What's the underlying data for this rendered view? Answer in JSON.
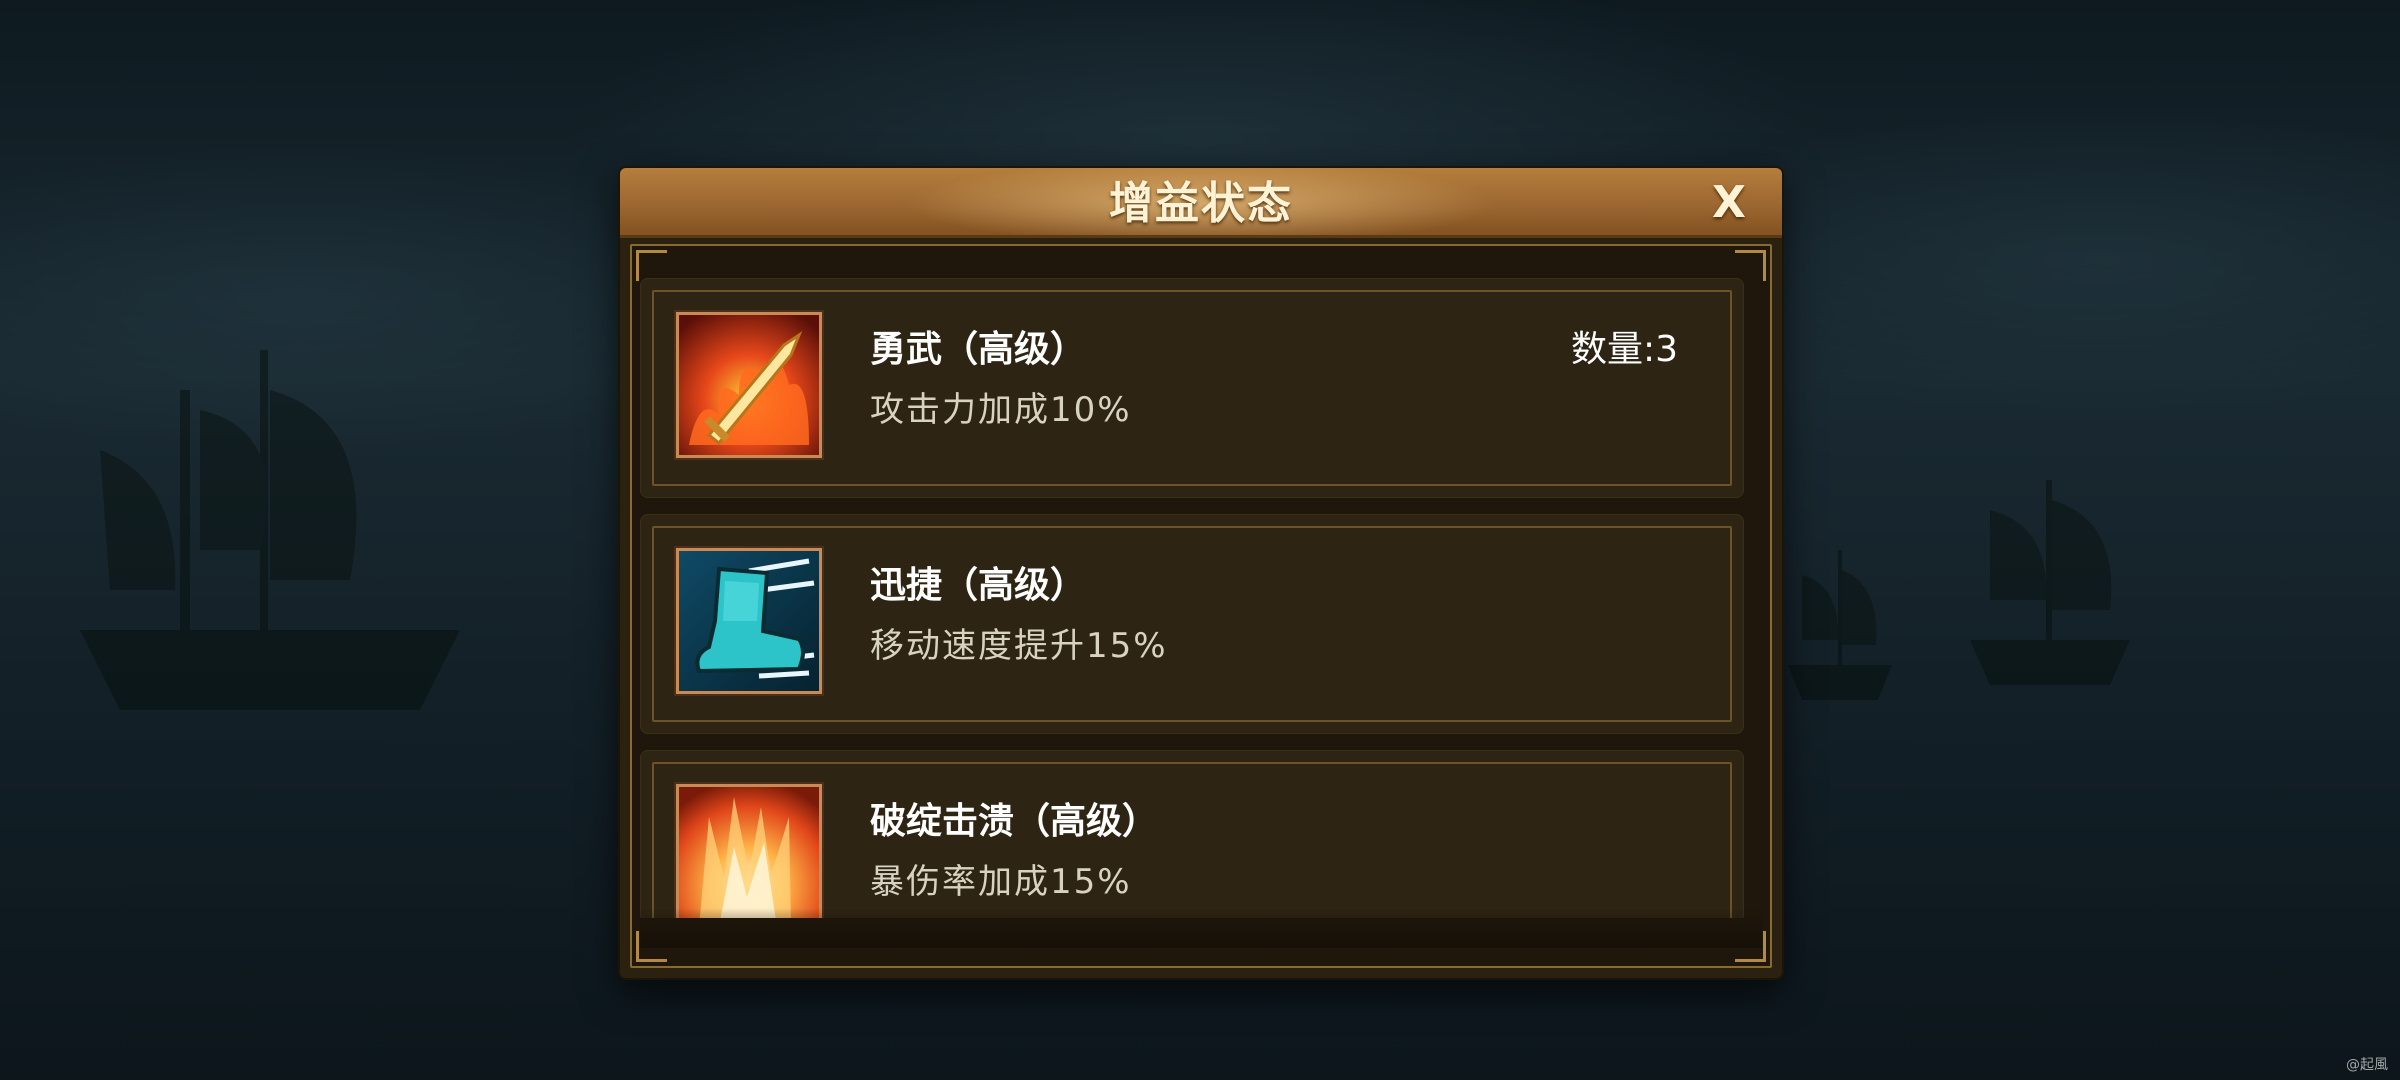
{
  "dialog": {
    "title": "增益状态",
    "close_label": "X"
  },
  "buffs": [
    {
      "name": "勇武（高级）",
      "description": "攻击力加成10%",
      "count": "数量:3",
      "icon": "flaming-sword-icon"
    },
    {
      "name": "迅捷（高级）",
      "description": "移动速度提升15%",
      "icon": "swift-boot-icon"
    },
    {
      "name": "破绽击溃（高级）",
      "description": "暴伤率加成15%",
      "icon": "flame-burst-icon"
    }
  ],
  "watermark": "@起風",
  "colors": {
    "header": "#9b6630",
    "panel": "#2b2110",
    "card": "#2e2414",
    "frame": "#8a6a30"
  }
}
